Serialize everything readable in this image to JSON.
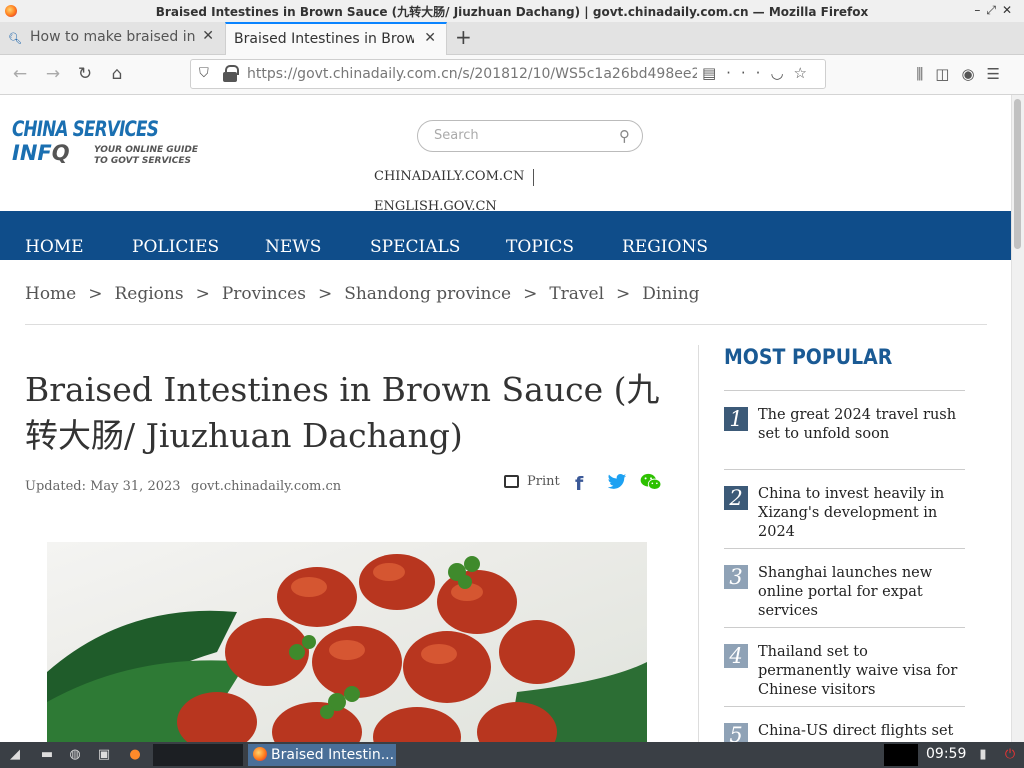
{
  "window": {
    "title": "Braised Intestines in Brown Sauce (九转大肠/ Jiuzhuan Dachang) | govt.chinadaily.com.cn — Mozilla Firefox"
  },
  "tabs": [
    {
      "label": "How to make braised int",
      "icon": "search-icon",
      "active": false
    },
    {
      "label": "Braised Intestines in Brown",
      "icon": "none",
      "active": true
    }
  ],
  "navbar": {
    "url": "https://govt.chinadaily.com.cn/s/201812/10/WS5c1a26bd498ee2"
  },
  "site": {
    "logo_line1": "CHINA SERVICES",
    "logo_line2a": "INF",
    "logo_line2b": "Q",
    "logo_tagline1": "YOUR ONLINE GUIDE",
    "logo_tagline2": "TO GOVT SERVICES",
    "search_placeholder": "Search",
    "top_links": [
      "CHINADAILY.COM.CN",
      "ENGLISH.GOV.CN"
    ],
    "nav": [
      "HOME",
      "POLICIES",
      "NEWS",
      "SPECIALS",
      "TOPICS",
      "REGIONS"
    ]
  },
  "breadcrumbs": [
    "Home",
    "Regions",
    "Provinces",
    "Shandong province",
    "Travel",
    "Dining"
  ],
  "breadcrumb_sep": ">",
  "article": {
    "headline": "Braised Intestines in Brown Sauce (九转大肠/ Jiuzhuan Dachang)",
    "updated": "Updated: May 31, 2023",
    "source": "govt.chinadaily.com.cn",
    "print_label": "Print",
    "fb_glyph": "f"
  },
  "most_popular": {
    "title": "MOST POPULAR",
    "items": [
      {
        "num": "1",
        "text": "The great 2024 travel rush set to unfold soon"
      },
      {
        "num": "2",
        "text": "China to invest heavily in Xizang's development in 2024"
      },
      {
        "num": "3",
        "text": "Shanghai launches new online portal for expat services"
      },
      {
        "num": "4",
        "text": "Thailand set to permanently waive visa for Chinese visitors"
      },
      {
        "num": "5",
        "text": "China-US direct flights set to"
      }
    ]
  },
  "taskbar": {
    "active_task": "Braised Intestin...",
    "clock": "09:59"
  },
  "colors": {
    "nav_blue": "#0f4d8a",
    "accent_blue": "#1a6fb1",
    "firefox_accent": "#0a84ff"
  }
}
